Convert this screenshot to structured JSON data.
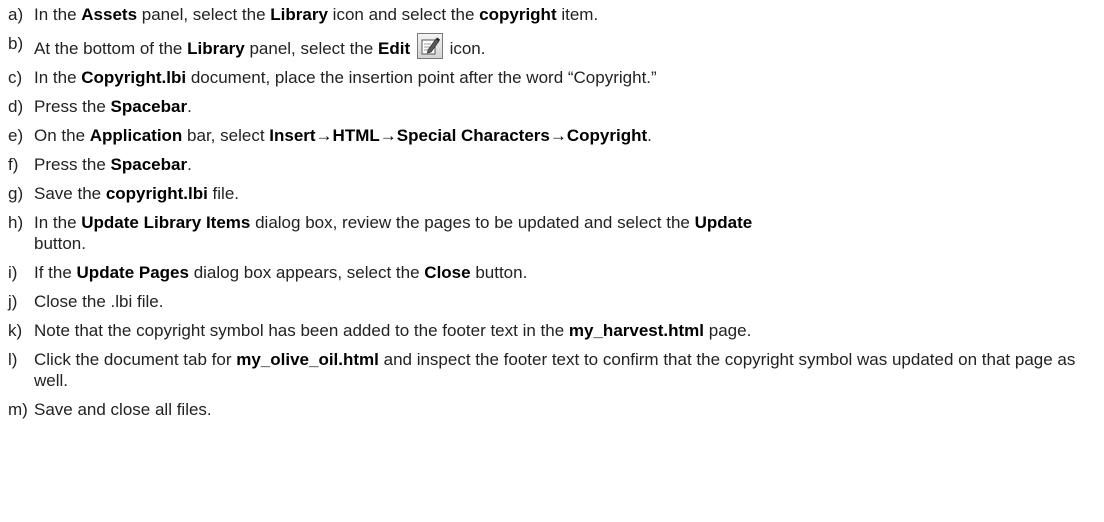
{
  "steps": [
    {
      "marker": "a)",
      "parts": [
        "In the ",
        "Assets",
        " panel, select the ",
        "Library",
        " icon and select the ",
        "copyright",
        " item."
      ]
    },
    {
      "marker": "b)",
      "parts": [
        "At the bottom of the ",
        "Library",
        " panel, select the ",
        "Edit",
        " ",
        "icon."
      ]
    },
    {
      "marker": "c)",
      "parts": [
        "In the ",
        "Copyright.lbi",
        " document, place the insertion point after the word “Copyright.”"
      ]
    },
    {
      "marker": "d)",
      "parts": [
        "Press the ",
        "Spacebar",
        "."
      ]
    },
    {
      "marker": "e)",
      "parts": [
        "On the ",
        "Application",
        " bar, select ",
        "Insert→HTML→Special Characters→Copyright",
        "."
      ]
    },
    {
      "marker": "f)",
      "parts": [
        "Press the ",
        "Spacebar",
        "."
      ]
    },
    {
      "marker": "g)",
      "parts": [
        "Save the ",
        "copyright.lbi",
        " file."
      ]
    },
    {
      "marker": "h)",
      "parts": [
        "In the ",
        "Update Library Items",
        " dialog box, review the pages to be updated and select the ",
        "Update",
        " button."
      ]
    },
    {
      "marker": "i)",
      "parts": [
        "If the ",
        "Update Pages",
        " dialog box appears, select the ",
        "Close",
        " button."
      ]
    },
    {
      "marker": "j)",
      "parts": [
        "Close the .lbi file."
      ]
    },
    {
      "marker": "k)",
      "parts": [
        "Note that the copyright symbol has been added to the footer text in the ",
        "my_harvest.html",
        " page."
      ]
    },
    {
      "marker": "l)",
      "parts": [
        "Click the document tab for ",
        "my_olive_oil.html",
        " and inspect the footer text to confirm that the copyright symbol was updated on that page as well."
      ]
    },
    {
      "marker": "m)",
      "parts": [
        "Save and close all files."
      ]
    }
  ],
  "icons": {
    "edit": "edit-icon"
  }
}
